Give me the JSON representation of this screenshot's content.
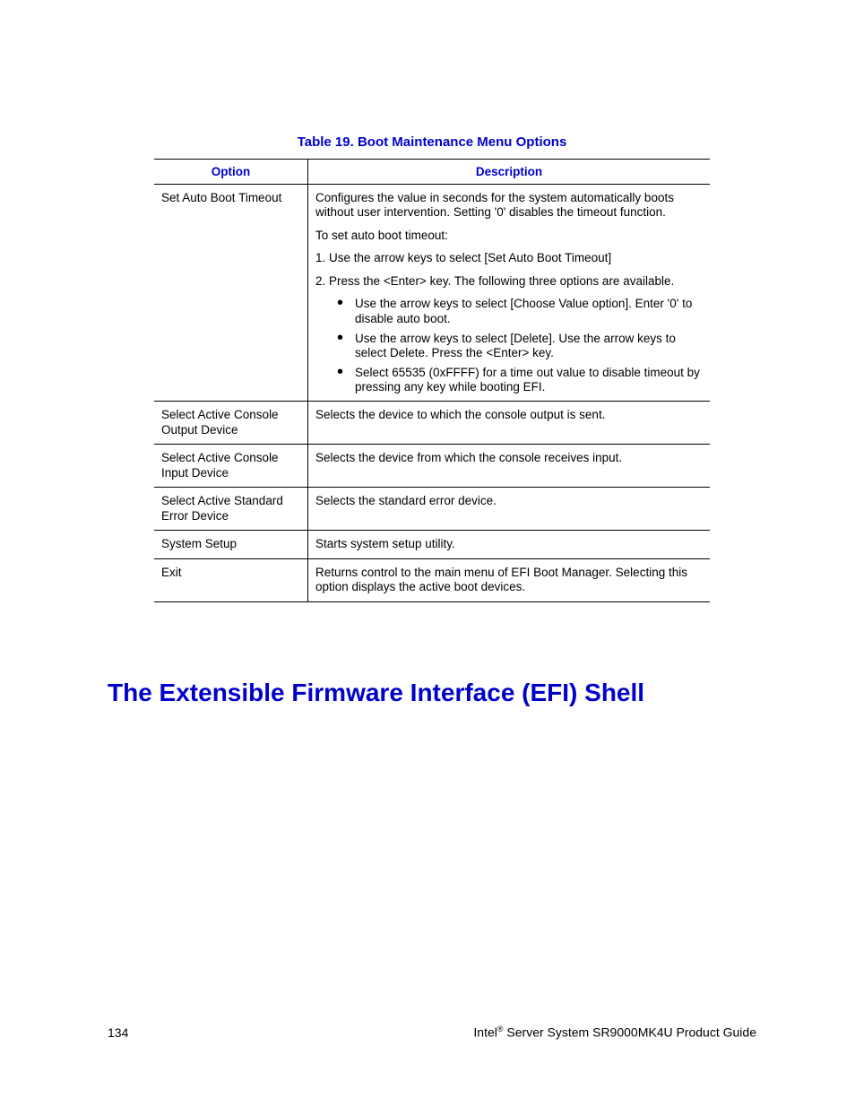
{
  "table": {
    "caption": "Table 19. Boot Maintenance Menu Options",
    "headers": {
      "option": "Option",
      "description": "Description"
    },
    "rows": [
      {
        "option": "Set Auto Boot Timeout",
        "paragraphs": [
          "Configures the value in seconds for the system automatically boots without user intervention. Setting '0' disables the timeout function.",
          "To set auto boot timeout:",
          "1. Use the arrow keys to select [Set Auto Boot Timeout]",
          "2. Press the <Enter> key. The following three options are available."
        ],
        "bullets": [
          "Use the arrow keys to select [Choose Value option]. Enter '0' to disable auto boot.",
          "Use the arrow keys to select [Delete]. Use the arrow keys to select Delete. Press the <Enter> key.",
          "Select 65535 (0xFFFF) for a time out value to disable timeout by pressing any key while booting EFI."
        ]
      },
      {
        "option": "Select Active Console Output Device",
        "paragraphs": [
          "Selects the device to which the console output is sent."
        ]
      },
      {
        "option": "Select Active Console Input Device",
        "paragraphs": [
          "Selects the device from which the console receives input."
        ]
      },
      {
        "option": "Select Active Standard Error Device",
        "paragraphs": [
          "Selects the standard error device."
        ]
      },
      {
        "option": "System Setup",
        "paragraphs": [
          "Starts system setup utility."
        ]
      },
      {
        "option": "Exit",
        "paragraphs": [
          "Returns control to the main menu of EFI Boot Manager. Selecting this option displays the active boot devices."
        ]
      }
    ]
  },
  "heading": "The Extensible Firmware Interface (EFI) Shell",
  "footer": {
    "page_number": "134",
    "brand": "Intel",
    "reg": "®",
    "product": " Server System SR9000MK4U Product Guide"
  }
}
